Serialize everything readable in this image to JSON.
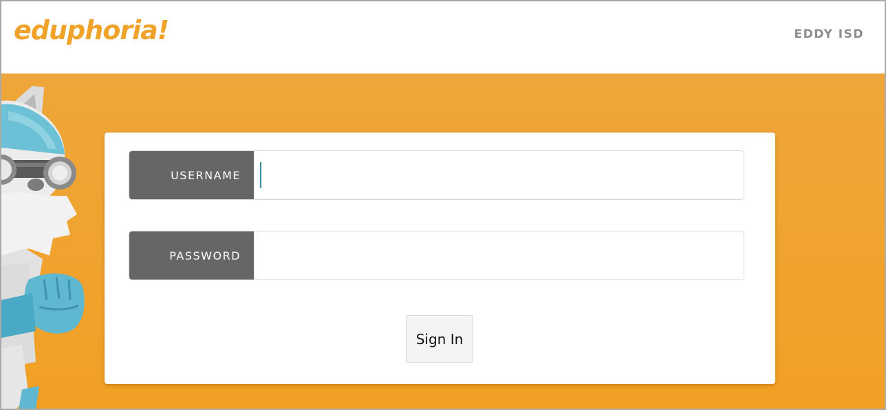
{
  "header": {
    "logo_text": "eduphoria!",
    "district_name": "EDDY ISD"
  },
  "login": {
    "username_label": "USERNAME",
    "username_value": "",
    "password_label": "PASSWORD",
    "password_value": "",
    "signin_label": "Sign In"
  },
  "colors": {
    "brand_orange": "#f0a32a",
    "label_gray": "#666666",
    "hero_top": "#eea63a",
    "hero_bottom": "#f1a024"
  },
  "icons": {
    "mascot": "goggle-wolf-mascot-icon"
  }
}
